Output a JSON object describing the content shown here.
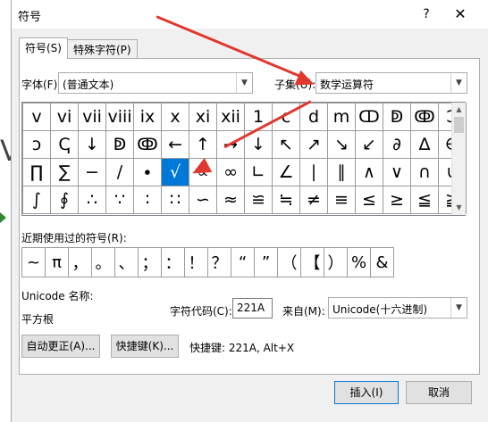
{
  "dialog": {
    "title": "符号",
    "help_label": "?",
    "close_label": "✕"
  },
  "tabs": [
    {
      "label": "符号(S)"
    },
    {
      "label": "特殊字符(P)"
    }
  ],
  "font": {
    "label": "字体(F):",
    "value": "(普通文本)"
  },
  "subset": {
    "label": "子集(U):",
    "value": "数学运算符"
  },
  "symbol_grid": [
    [
      "v",
      "vi",
      "vii",
      "viii",
      "ix",
      "x",
      "xi",
      "xii",
      "1",
      "c",
      "d",
      "m",
      "ↀ",
      "ↁ",
      "ↂ",
      "Ↄ"
    ],
    [
      "ↄ",
      "ↅ",
      "↓",
      "ↁ",
      "ↂ",
      "←",
      "↑",
      "→",
      "↓",
      "↖",
      "↗",
      "↘",
      "↙",
      "∂",
      "∆",
      "∈"
    ],
    [
      "∏",
      "∑",
      "−",
      "∕",
      "∙",
      "√",
      "∝",
      "∞",
      "∟",
      "∠",
      "∣",
      "∥",
      "∧",
      "∨",
      "∩",
      "∪"
    ],
    [
      "∫",
      "∮",
      "∴",
      "∵",
      "∶",
      "∷",
      "∽",
      "≈",
      "≌",
      "≒",
      "≠",
      "≡",
      "≤",
      "≥",
      "≦",
      "≧"
    ]
  ],
  "selected_symbol": "√",
  "recent": {
    "label": "近期使用过的符号(R):",
    "symbols": [
      "~",
      "π",
      "，",
      "。",
      "、",
      "；",
      "：",
      "！",
      "？",
      "“",
      "”",
      "（",
      "【",
      "）",
      "%",
      "&"
    ]
  },
  "unicode_name": {
    "label": "Unicode 名称:",
    "value": "平方根"
  },
  "char_code": {
    "label": "字符代码(C):",
    "value": "221A"
  },
  "from": {
    "label": "来自(M):",
    "value": "Unicode(十六进制)"
  },
  "buttons": {
    "autocorrect": "自动更正(A)...",
    "shortcut_key": "快捷键(K)...",
    "shortcut_text": "快捷键: 221A, Alt+X",
    "insert": "插入(I)",
    "cancel": "取消"
  },
  "background": {
    "glyph": "V"
  },
  "colors": {
    "selection": "#0078d7",
    "annotation_arrow": "#e0382f"
  }
}
